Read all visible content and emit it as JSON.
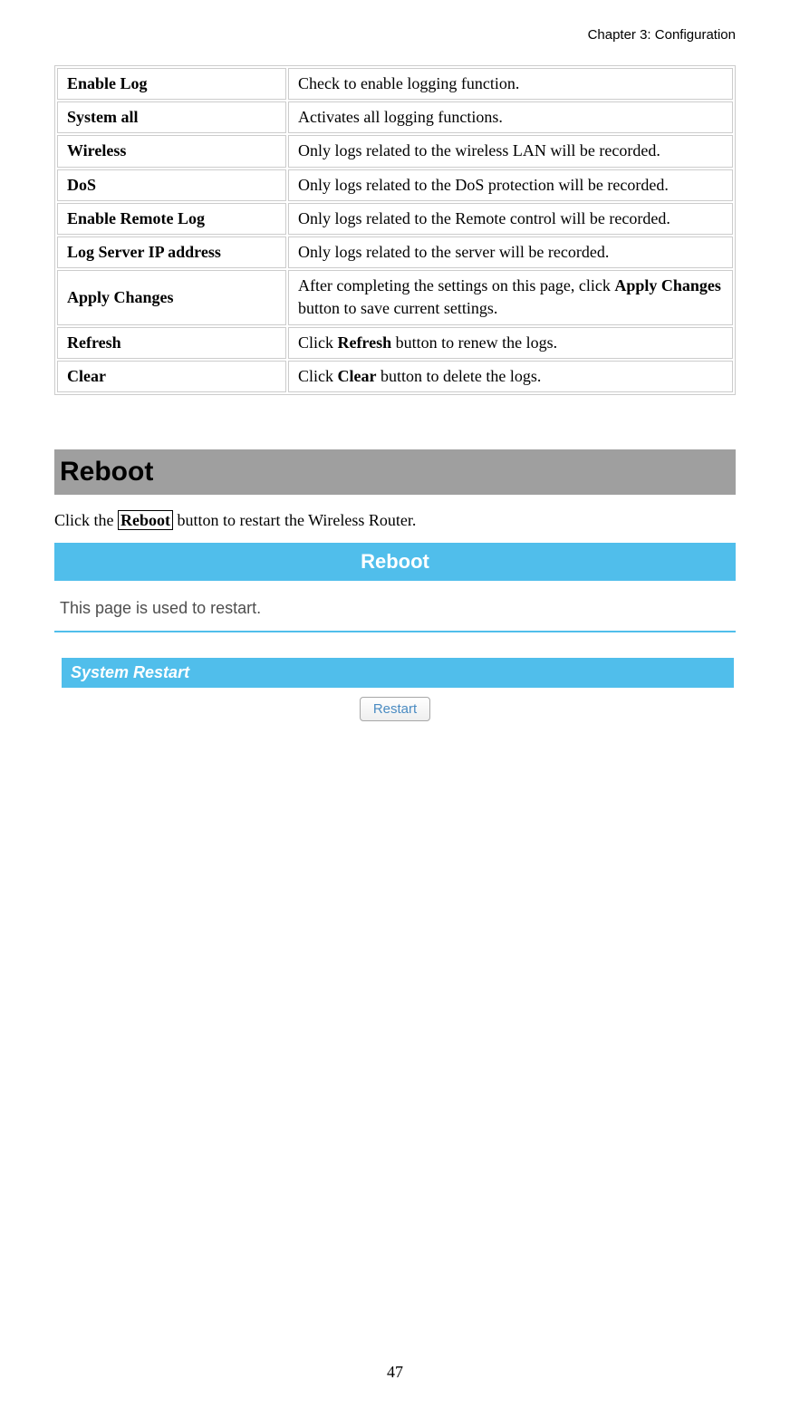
{
  "header": "Chapter 3: Configuration",
  "table": {
    "rows": [
      {
        "label": "Enable Log",
        "desc": "Check to enable logging function."
      },
      {
        "label": "System all",
        "desc": "Activates all logging functions."
      },
      {
        "label": "Wireless",
        "desc": "Only logs related to the wireless LAN will be recorded."
      },
      {
        "label": "DoS",
        "desc": "Only logs related to the DoS protection will be recorded."
      },
      {
        "label": "Enable Remote Log",
        "desc": "Only logs related to the Remote control will be recorded."
      },
      {
        "label": "Log Server IP address",
        "desc": "Only logs related to the server will be recorded."
      }
    ],
    "applyRow": {
      "label": "Apply Changes",
      "pre": "After completing the settings on this page, click ",
      "bold": "Apply Changes",
      "post": " button to save current settings."
    },
    "refreshRow": {
      "label": "Refresh",
      "pre": "Click ",
      "bold": "Refresh",
      "post": " button to renew the logs."
    },
    "clearRow": {
      "label": "Clear",
      "pre": "Click ",
      "bold": "Clear",
      "post": " button to delete the logs."
    }
  },
  "section": {
    "heading": "Reboot",
    "intro_pre": "Click the ",
    "intro_bold": "Reboot",
    "intro_post": " button to restart the Wireless Router."
  },
  "screenshot": {
    "titlebar": "Reboot",
    "desc": "This page is used to restart.",
    "panel_header": "System Restart",
    "button": "Restart"
  },
  "pageNumber": "47"
}
